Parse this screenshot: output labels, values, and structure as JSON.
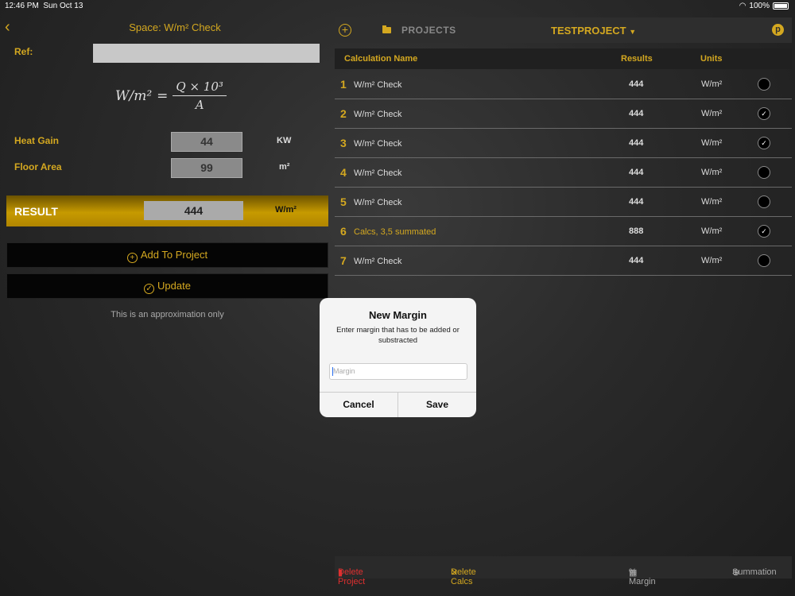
{
  "status_bar": {
    "time": "12:46 PM",
    "date": "Sun Oct 13",
    "battery": "100%"
  },
  "left": {
    "title": "Space: W/m² Check",
    "ref_label": "Ref:",
    "ref_value": "",
    "formula": {
      "lhs": "W/m²",
      "num": "Q × 10³",
      "den": "A"
    },
    "heat_gain": {
      "label": "Heat Gain",
      "value": "44",
      "unit": "KW"
    },
    "floor_area": {
      "label": "Floor Area",
      "value": "99",
      "unit": "m²"
    },
    "result": {
      "label": "RESULT",
      "value": "444",
      "unit": "W/m²"
    },
    "add_button": "Add To Project",
    "update_button": "Update",
    "approx_note": "This is an approximation only"
  },
  "right": {
    "projects_label": "PROJECTS",
    "project_name": "TESTPROJECT",
    "columns": {
      "name": "Calculation Name",
      "results": "Results",
      "units": "Units"
    },
    "rows": [
      {
        "num": "1",
        "name": "W/m² Check",
        "result": "444",
        "unit": "W/m²",
        "checked": false
      },
      {
        "num": "2",
        "name": "W/m² Check",
        "result": "444",
        "unit": "W/m²",
        "checked": true
      },
      {
        "num": "3",
        "name": "W/m² Check",
        "result": "444",
        "unit": "W/m²",
        "checked": true
      },
      {
        "num": "4",
        "name": "W/m² Check",
        "result": "444",
        "unit": "W/m²",
        "checked": false
      },
      {
        "num": "5",
        "name": "W/m² Check",
        "result": "444",
        "unit": "W/m²",
        "checked": false
      },
      {
        "num": "6",
        "name": "Calcs, 3,5 summated",
        "result": "888",
        "unit": "W/m²",
        "checked": true
      },
      {
        "num": "7",
        "name": "W/m² Check",
        "result": "444",
        "unit": "W/m²",
        "checked": false
      }
    ],
    "bottom": {
      "delete_project": "Delete Project",
      "delete_calcs": "Delete Calcs",
      "margin": "% Margin",
      "summation": "Summation"
    }
  },
  "dialog": {
    "title": "New Margin",
    "message": "Enter margin that has to be added or substracted",
    "placeholder": "Margin",
    "cancel": "Cancel",
    "save": "Save"
  },
  "colors": {
    "accent": "#d4a820",
    "danger": "#e03030"
  }
}
